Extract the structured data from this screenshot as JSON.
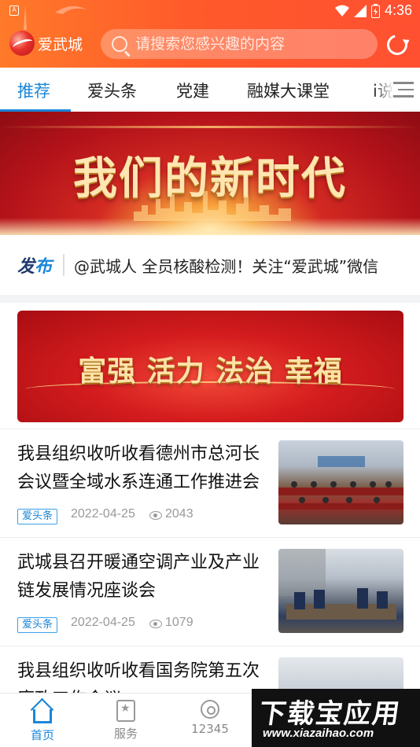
{
  "status_bar": {
    "time": "4:36",
    "badge": "A"
  },
  "header": {
    "logo_text": "爱武城",
    "search_placeholder": "请搜索您感兴趣的内容"
  },
  "tabs": [
    {
      "label": "推荐",
      "active": true
    },
    {
      "label": "爱头条"
    },
    {
      "label": "党建"
    },
    {
      "label": "融媒大课堂"
    },
    {
      "label": "i说"
    }
  ],
  "hero": {
    "title": "我们的新时代"
  },
  "release": {
    "brand_a": "发",
    "brand_b": "布",
    "text": "@武城人  全员核酸检测！关注“爱武城”微信"
  },
  "banner2": {
    "slogan": "富强 活力 法治 幸福"
  },
  "news": [
    {
      "title": "我县组织收听收看德州市总河长会议暨全域水系连通工作推进会议",
      "tag": "爱头条",
      "date": "2022-04-25",
      "views": "2043"
    },
    {
      "title": "武城县召开暖通空调产业及产业链发展情况座谈会",
      "tag": "爱头条",
      "date": "2022-04-25",
      "views": "1079"
    },
    {
      "title": "我县组织收听收看国务院第五次廉政工作会议",
      "tag": "",
      "date": "",
      "views": ""
    }
  ],
  "bottom_nav": [
    {
      "label": "首页",
      "icon": "home-icon",
      "active": true
    },
    {
      "label": "服务",
      "icon": "bookmark-star-icon"
    },
    {
      "label": "12345",
      "icon": "phone-hotline-icon"
    }
  ],
  "watermark": {
    "big": "下载宝应用",
    "small": "www.xiazaihao.com"
  },
  "colors": {
    "accent": "#1a86d8",
    "header": "#ff5a2a"
  }
}
